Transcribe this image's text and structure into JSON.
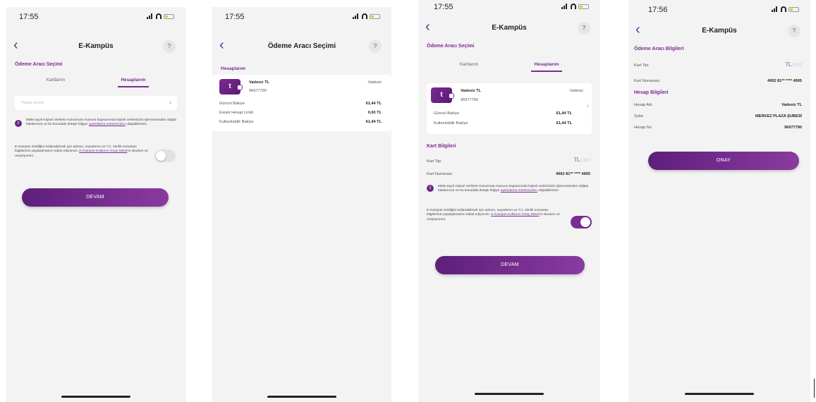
{
  "screen1": {
    "time": "17:55",
    "title": "E-Kampüs",
    "help": "?",
    "section_title": "Ödeme Aracı Seçimi",
    "tabs": [
      "Kartlarım",
      "Hesaplarım"
    ],
    "select_placeholder": "Hesap seçiniz",
    "kvkk_text": "6698 sayılı Kişisel Verilerin Korunması Kanunu kapsamında kişisel verilerinizin işlenmesinden doğan haklarınıza ve bu konudaki detaylı bilgiye",
    "kvkk_link": "aydınlatma metnimizden",
    "kvkk_suffix": "ulaşabilirsiniz.",
    "consent_text": "E-Kampüs özelliğini kullanabilmek için adımın, soyadımın ve T.C. kimlik numarası bilgilerimin paylaşılmasını kabul ediyorum.",
    "consent_link": "E-Kampüs Kullanım Onay Metni",
    "consent_suffix": "'ni okudum ve onaylıyorum.",
    "button": "DEVAM"
  },
  "screen2": {
    "time": "17:55",
    "title": "Ödeme Aracı Seçimi",
    "help": "?",
    "section_title": "Hesaplarım",
    "account": {
      "name": "Vadesiz TL",
      "number": "96977790",
      "type": "Vadesiz",
      "icon_glyph": "t"
    },
    "rows": [
      {
        "label": "Güncel Bakiye",
        "value": "61,44 TL"
      },
      {
        "label": "Esnek Hesap Limiti",
        "value": "0,00 TL"
      },
      {
        "label": "Kullanılabilir Bakiye",
        "value": "61,44 TL"
      }
    ]
  },
  "screen3": {
    "time": "17:55",
    "title": "E-Kampüs",
    "help": "?",
    "section_title": "Ödeme Aracı Seçimi",
    "tabs": [
      "Kartlarım",
      "Hesaplarım"
    ],
    "account": {
      "name": "Vadesiz TL",
      "number": "96977790",
      "type": "Vadesiz",
      "icon_glyph": "t"
    },
    "rows": [
      {
        "label": "Güncel Bakiye",
        "value": "61,44 TL"
      },
      {
        "label": "Kullanılabilir Bakiye",
        "value": "61,44 TL"
      }
    ],
    "card_section_title": "Kart Bilgileri",
    "card_type_label": "Kart Tipi",
    "card_type_logo": "TL",
    "card_type_logo_suffix": "card",
    "card_number_label": "Kart Numarası",
    "card_number": "4062 81** **** 4905",
    "kvkk_text": "6698 sayılı Kişisel Verilerin Korunması Kanunu kapsamında kişisel verilerinizin işlenmesinden doğan haklarınıza ve bu konudaki detaylı bilgiye",
    "kvkk_link": "aydınlatma metnimizden",
    "kvkk_suffix": "ulaşabilirsiniz.",
    "consent_text": "E-Kampüs özelliğini kullanabilmek için adımın, soyadımın ve T.C. kimlik numarası bilgilerimin paylaşılmasını kabul ediyorum.",
    "consent_link": "E-Kampüs Kullanım Onay Metni",
    "consent_suffix": "'ni okudum ve onaylıyorum.",
    "button": "DEVAM"
  },
  "screen4": {
    "time": "17:56",
    "title": "E-Kampüs",
    "help": "?",
    "section_title": "Ödeme Aracı Bilgileri",
    "card_type_label": "Kart Tipi",
    "card_type_logo": "TL",
    "card_type_logo_suffix": "card",
    "card_number_label": "Kart Numarası",
    "card_number": "4062 81** **** 4905",
    "account_section_title": "Hesap Bilgileri",
    "account_rows": [
      {
        "label": "Hesap Adı",
        "value": "Vadesiz TL"
      },
      {
        "label": "Şube",
        "value": "MERKEZ PLAZA ŞUBESİ"
      },
      {
        "label": "Hesap No",
        "value": "96977790"
      }
    ],
    "button": "ONAY"
  }
}
